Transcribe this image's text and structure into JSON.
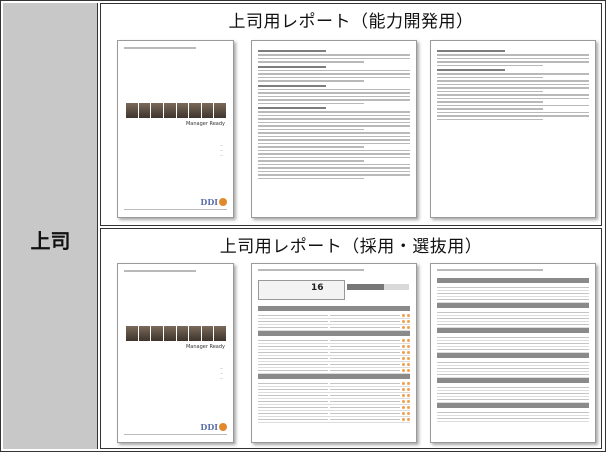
{
  "left_column": {
    "label": "上司"
  },
  "sections": [
    {
      "title": "上司用レポート（能力開発用）"
    },
    {
      "title": "上司用レポート（採用・選抜用）"
    }
  ],
  "cover": {
    "title": "Manager Ready",
    "ddi_logo": "DDI"
  },
  "section2_mid": {
    "score": "16"
  }
}
